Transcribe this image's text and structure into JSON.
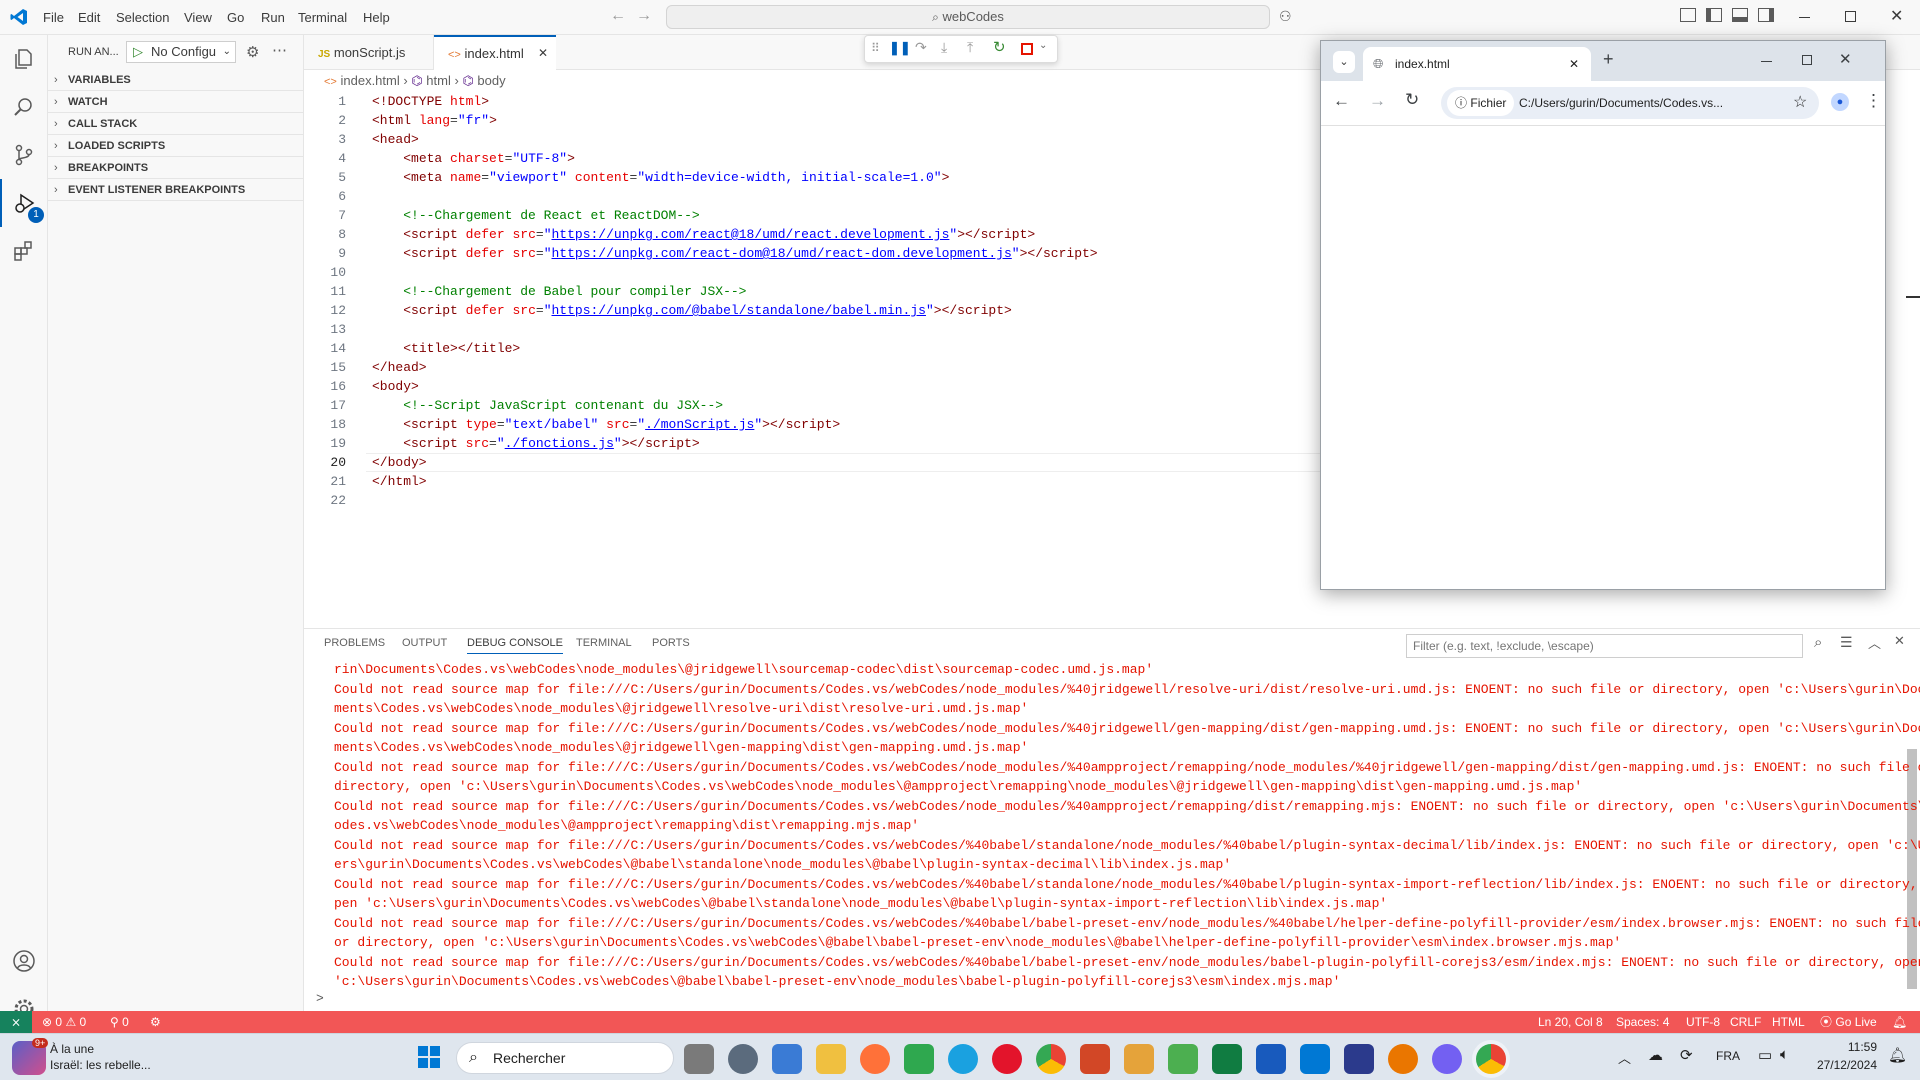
{
  "titlebar": {
    "menu": [
      "File",
      "Edit",
      "Selection",
      "View",
      "Go",
      "Run",
      "Terminal",
      "Help"
    ],
    "command_center": "webCodes"
  },
  "run_view": {
    "title": "RUN AN...",
    "config": "No Configu",
    "sections": [
      "VARIABLES",
      "WATCH",
      "CALL STACK",
      "LOADED SCRIPTS",
      "BREAKPOINTS",
      "EVENT LISTENER BREAKPOINTS"
    ],
    "debug_badge": "1"
  },
  "tabs": [
    {
      "label": "monScript.js",
      "icon": "JS"
    },
    {
      "label": "index.html",
      "icon": "<>"
    }
  ],
  "breadcrumb": [
    "index.html",
    "html",
    "body"
  ],
  "editor": {
    "lines": [
      "1",
      "2",
      "3",
      "4",
      "5",
      "6",
      "7",
      "8",
      "9",
      "10",
      "11",
      "12",
      "13",
      "14",
      "15",
      "16",
      "17",
      "18",
      "19",
      "20",
      "21",
      "22"
    ],
    "current_line": "20"
  },
  "panel": {
    "tabs": [
      "PROBLEMS",
      "OUTPUT",
      "DEBUG CONSOLE",
      "TERMINAL",
      "PORTS"
    ],
    "active_tab": "DEBUG CONSOLE",
    "filter_placeholder": "Filter (e.g. text, !exclude, \\escape)",
    "log_lines": [
      "rin\\Documents\\Codes.vs\\webCodes\\node_modules\\@jridgewell\\sourcemap-codec\\dist\\sourcemap-codec.umd.js.map'",
      "Could not read source map for file:///C:/Users/gurin/Documents/Codes.vs/webCodes/node_modules/%40jridgewell/resolve-uri/dist/resolve-uri.umd.js: ENOENT: no such file or directory, open 'c:\\Users\\gurin\\Docu",
      "ments\\Codes.vs\\webCodes\\node_modules\\@jridgewell\\resolve-uri\\dist\\resolve-uri.umd.js.map'",
      "Could not read source map for file:///C:/Users/gurin/Documents/Codes.vs/webCodes/node_modules/%40jridgewell/gen-mapping/dist/gen-mapping.umd.js: ENOENT: no such file or directory, open 'c:\\Users\\gurin\\Docu",
      "ments\\Codes.vs\\webCodes\\node_modules\\@jridgewell\\gen-mapping\\dist\\gen-mapping.umd.js.map'",
      "Could not read source map for file:///C:/Users/gurin/Documents/Codes.vs/webCodes/node_modules/%40ampproject/remapping/node_modules/%40jridgewell/gen-mapping/dist/gen-mapping.umd.js: ENOENT: no such file or",
      "directory, open 'c:\\Users\\gurin\\Documents\\Codes.vs\\webCodes\\node_modules\\@ampproject\\remapping\\node_modules\\@jridgewell\\gen-mapping\\dist\\gen-mapping.umd.js.map'",
      "Could not read source map for file:///C:/Users/gurin/Documents/Codes.vs/webCodes/node_modules/%40ampproject/remapping/dist/remapping.mjs: ENOENT: no such file or directory, open 'c:\\Users\\gurin\\Documents\\C",
      "odes.vs\\webCodes\\node_modules\\@ampproject\\remapping\\dist\\remapping.mjs.map'",
      "Could not read source map for file:///C:/Users/gurin/Documents/Codes.vs/webCodes/%40babel/standalone/node_modules/%40babel/plugin-syntax-decimal/lib/index.js: ENOENT: no such file or directory, open 'c:\\Us",
      "ers\\gurin\\Documents\\Codes.vs\\webCodes\\@babel\\standalone\\node_modules\\@babel\\plugin-syntax-decimal\\lib\\index.js.map'",
      "Could not read source map for file:///C:/Users/gurin/Documents/Codes.vs/webCodes/%40babel/standalone/node_modules/%40babel/plugin-syntax-import-reflection/lib/index.js: ENOENT: no such file or directory, o",
      "pen 'c:\\Users\\gurin\\Documents\\Codes.vs\\webCodes\\@babel\\standalone\\node_modules\\@babel\\plugin-syntax-import-reflection\\lib\\index.js.map'",
      "Could not read source map for file:///C:/Users/gurin/Documents/Codes.vs/webCodes/%40babel/babel-preset-env/node_modules/%40babel/helper-define-polyfill-provider/esm/index.browser.mjs: ENOENT: no such file",
      "or directory, open 'c:\\Users\\gurin\\Documents\\Codes.vs\\webCodes\\@babel\\babel-preset-env\\node_modules\\@babel\\helper-define-polyfill-provider\\esm\\index.browser.mjs.map'",
      "Could not read source map for file:///C:/Users/gurin/Documents/Codes.vs/webCodes/%40babel/babel-preset-env/node_modules/babel-plugin-polyfill-corejs3/esm/index.mjs: ENOENT: no such file or directory, open",
      "'c:\\Users\\gurin\\Documents\\Codes.vs\\webCodes\\@babel\\babel-preset-env\\node_modules\\babel-plugin-polyfill-corejs3\\esm\\index.mjs.map'"
    ],
    "prompt": ">"
  },
  "statusbar": {
    "errors": "0",
    "warnings": "0",
    "ports": "0",
    "position": "Ln 20, Col 8",
    "spaces": "Spaces: 4",
    "encoding": "UTF-8",
    "eol": "CRLF",
    "language": "HTML",
    "golive": "Go Live"
  },
  "browser": {
    "tab_title": "index.html",
    "site_label": "Fichier",
    "url": "C:/Users/gurin/Documents/Codes.vs..."
  },
  "taskbar": {
    "news_badge": "9+",
    "news_title": "À la une",
    "news_text": "Israël: les rebelle...",
    "search": "Rechercher",
    "lang": "FRA",
    "time": "11:59",
    "date": "27/12/2024"
  },
  "colors": {
    "statusbar": "#f25656",
    "accent": "#005fb8",
    "log_error": "#e51400"
  }
}
